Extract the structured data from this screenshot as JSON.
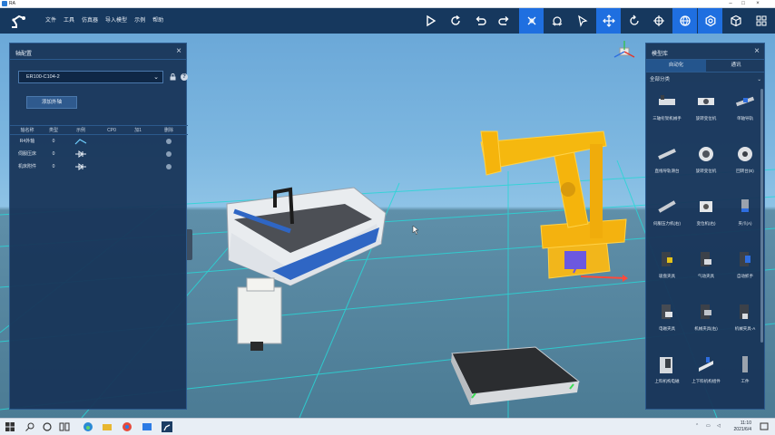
{
  "window": {
    "title": "RA"
  },
  "menu": [
    "文件",
    "工具",
    "仿真器",
    "导入模型",
    "示例",
    "帮助"
  ],
  "toolbar_icons": [
    "play-icon",
    "refresh-icon",
    "undo-icon",
    "redo-icon",
    "select-pointer-icon",
    "teach-icon",
    "cursor-icon",
    "move-icon",
    "rotate-icon",
    "target-icon",
    "globe-icon",
    "gear-icon",
    "box-icon",
    "apps-icon"
  ],
  "left_panel": {
    "title": "轴配置",
    "robot_select_value": "ER100-C104-2",
    "add_button": "添加外轴",
    "table_headers": [
      "轴名称",
      "类型",
      "示例",
      "CP0",
      "加1",
      "删除"
    ],
    "rows": [
      {
        "name": "R4外轴",
        "type": "0",
        "icon": "bent-arrow-icon"
      },
      {
        "name": "伺服压床",
        "type": "0",
        "icon": "diode-icon"
      },
      {
        "name": "机床附件",
        "type": "0",
        "icon": "diode-icon"
      }
    ]
  },
  "right_panel": {
    "title": "模型库",
    "tabs": [
      "自动化",
      "通讯"
    ],
    "category": "全部分类",
    "items": [
      "三轴桁架机械手",
      "旋转变位机",
      "单轴导轨",
      "直线导轨滑台",
      "旋转变位机",
      "回转台(B)",
      "伺服压力机(右)",
      "变位机(右)",
      "夹爪(A)",
      "吸盘夹具",
      "气动夹具",
      "自动抓手",
      "电磁夹具",
      "机械夹具(右)",
      "机械夹具-A",
      "上料机构电磁",
      "上下料机构组件",
      "工件"
    ]
  },
  "taskbar": {
    "time": "11:10",
    "date": "2021/6/4"
  }
}
